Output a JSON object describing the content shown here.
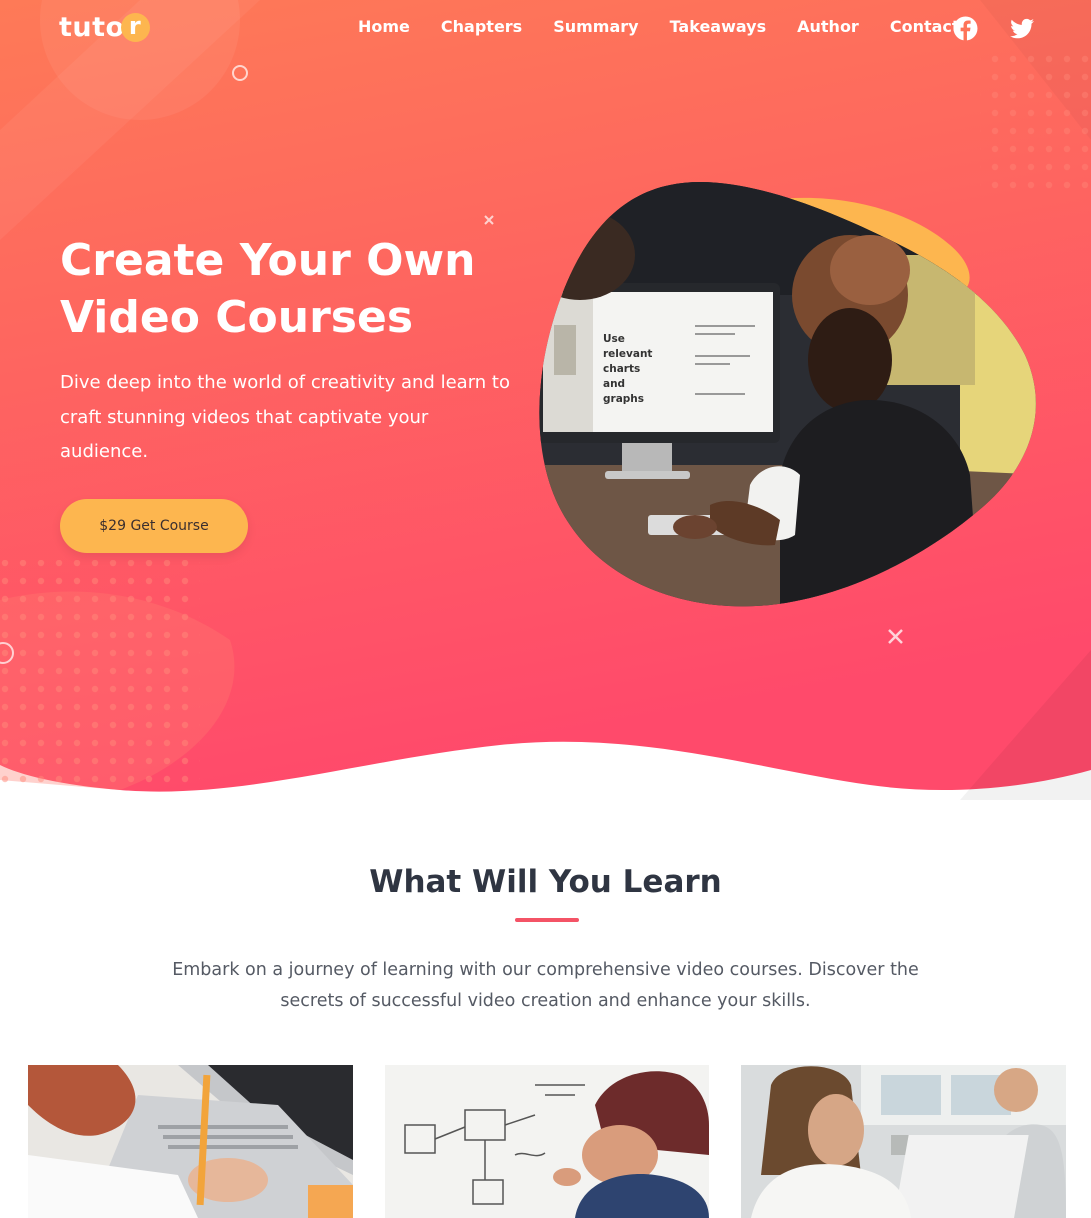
{
  "brand": {
    "logo_text": "tuto",
    "logo_letter": "r"
  },
  "nav": {
    "items": [
      "Home",
      "Chapters",
      "Summary",
      "Takeaways",
      "Author",
      "Contact"
    ],
    "social_icons": [
      "facebook-icon",
      "twitter-icon"
    ]
  },
  "hero": {
    "title": "Create Your Own Video Courses",
    "subtitle": "Dive deep into the world of creativity and learn to craft stunning videos that captivate your audience.",
    "cta_label": "$29 Get Course",
    "screen_text": "Use relevant charts and graphs"
  },
  "learn": {
    "title": "What Will You Learn",
    "description": "Embark on a journey of learning with our comprehensive video courses. Discover the secrets of successful video creation and enhance your skills."
  },
  "colors": {
    "hero_top": "#fe7a57",
    "hero_bottom": "#ff4d6a",
    "accent_yellow": "#fdb64f",
    "heading": "#2f3542",
    "underline": "#f45366"
  }
}
